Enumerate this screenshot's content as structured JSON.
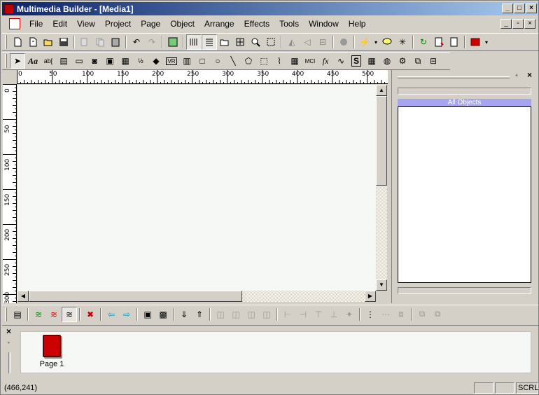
{
  "window": {
    "title": "Multimedia Builder - [Media1]",
    "controls": [
      "_",
      "□",
      "×"
    ]
  },
  "menu": [
    "File",
    "Edit",
    "View",
    "Project",
    "Page",
    "Object",
    "Arrange",
    "Effects",
    "Tools",
    "Window",
    "Help"
  ],
  "mdi_controls": [
    "_",
    "▫",
    "×"
  ],
  "ruler": {
    "h_labels": [
      "0",
      "50",
      "100",
      "150",
      "200",
      "250",
      "300",
      "350",
      "400",
      "450",
      "500"
    ],
    "v_labels": [
      "0",
      "50",
      "100",
      "150",
      "200",
      "250",
      "300"
    ]
  },
  "tool_glyphs": {
    "text": "Aa",
    "textfield": "ab[",
    "vr": "VR",
    "mci": "MCI",
    "fx": "fx",
    "s": "S"
  },
  "right_panel": {
    "close": "×",
    "all_objects_label": "All Objects"
  },
  "pages": {
    "close": "×",
    "items": [
      {
        "label": "Page 1"
      }
    ]
  },
  "status": {
    "coords": "(466,241)",
    "cells": [
      "",
      "",
      "SCRL"
    ]
  },
  "colors": {
    "title_start": "#0a246a",
    "title_end": "#a6caf0",
    "canvas_bg": "#f5f8f5",
    "panel_label_bg": "#a6a6f0",
    "page_icon": "#cc0000"
  }
}
